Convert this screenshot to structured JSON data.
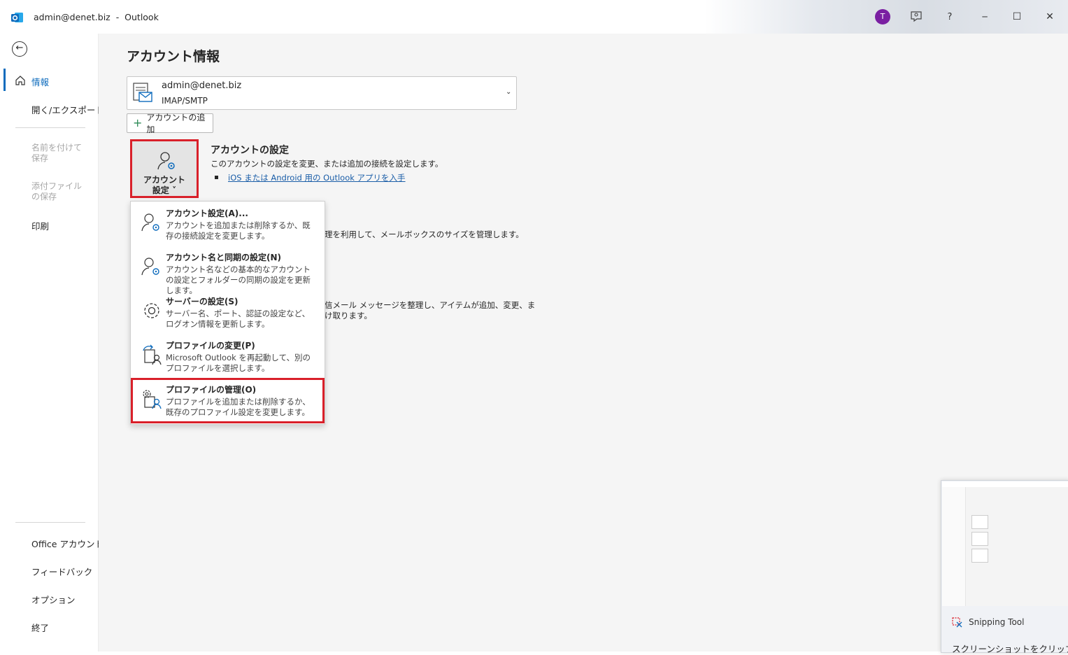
{
  "titlebar": {
    "title": "admin@denet.biz  -  Outlook",
    "avatar_letter": "T",
    "help": "?",
    "minimize": "─",
    "maximize": "☐",
    "close": "✕"
  },
  "sidebar": {
    "back": "←",
    "items": [
      {
        "label": "情報"
      },
      {
        "label": "開く/エクスポート"
      },
      {
        "label": "名前を付けて保存"
      },
      {
        "label": "添付ファイルの保存"
      },
      {
        "label": "印刷"
      }
    ],
    "bottom": [
      {
        "label": "Office アカウント"
      },
      {
        "label": "フィードバック"
      },
      {
        "label": "オプション"
      },
      {
        "label": "終了"
      }
    ]
  },
  "main": {
    "heading": "アカウント情報",
    "account": {
      "email": "admin@denet.biz",
      "type": "IMAP/SMTP"
    },
    "add_account": "アカウントの追加",
    "tile_label_1": "アカウント",
    "tile_label_2": "設定 ˅",
    "settings_title": "アカウントの設定",
    "settings_text": "このアカウントの設定を変更、または追加の接続を設定します。",
    "settings_link": "iOS または Android 用の Outlook アプリを入手",
    "hidden_text_1": "理を利用して、メールボックスのサイズを管理します。",
    "hidden_text_2": "信メール メッセージを整理し、アイテムが追加、変更、ま",
    "hidden_text_3": "け取ります。"
  },
  "menu": {
    "items": [
      {
        "title": "アカウント設定(A)...",
        "desc": "アカウントを追加または削除するか、既存の接続設定を変更します。"
      },
      {
        "title": "アカウント名と同期の設定(N)",
        "desc": "アカウント名などの基本的なアカウントの設定とフォルダーの同期の設定を更新します。"
      },
      {
        "title": "サーバーの設定(S)",
        "desc": "サーバー名、ポート、認証の設定など、ログオン情報を更新します。"
      },
      {
        "title": "プロファイルの変更(P)",
        "desc": "Microsoft Outlook を再起動して、別のプロファイルを選択します。"
      },
      {
        "title": "プロファイルの管理(O)",
        "desc": "プロファイルを追加または削除するか、既存のプロファイル設定を変更します。"
      }
    ]
  },
  "snipping": {
    "app": "Snipping Tool",
    "message": "スクリーンショットをクリップボード"
  },
  "colors": {
    "accent": "#0f6cbd",
    "highlight": "#d9202a",
    "avatar": "#7a1fa2",
    "link": "#1b5ea8"
  }
}
